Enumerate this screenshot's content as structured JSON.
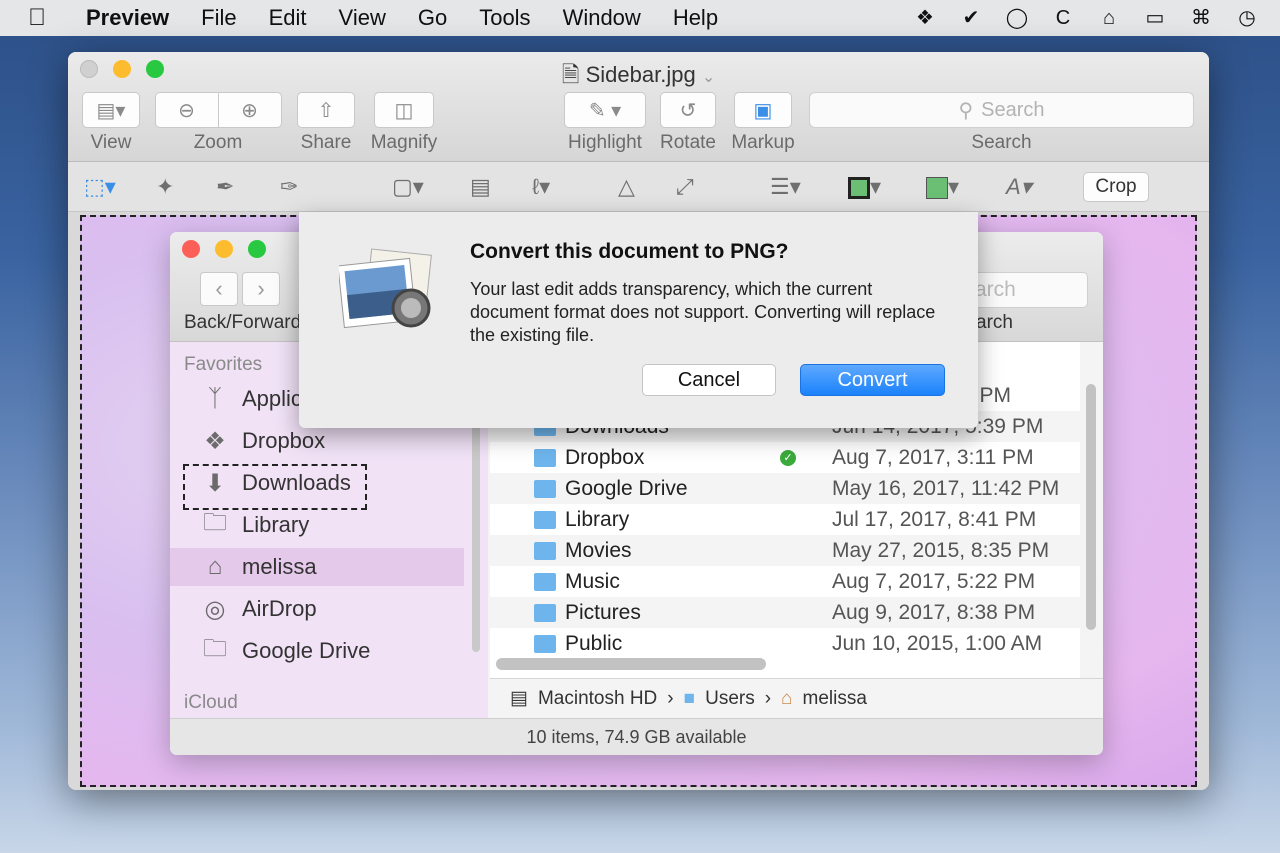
{
  "menubar": {
    "app": "Preview",
    "items": [
      "File",
      "Edit",
      "View",
      "Go",
      "Tools",
      "Window",
      "Help"
    ],
    "status_icons": [
      "dropbox-icon",
      "checkmark-icon",
      "1password-icon",
      "c-icon",
      "home-icon",
      "airplay-icon",
      "keyboard-icon",
      "time-machine-icon"
    ]
  },
  "preview": {
    "title": "Sidebar.jpg",
    "toolbar": {
      "view": "View",
      "zoom": "Zoom",
      "share": "Share",
      "magnify": "Magnify",
      "highlight": "Highlight",
      "rotate": "Rotate",
      "markup": "Markup",
      "search_placeholder": "Search",
      "search_label": "Search"
    },
    "markup": {
      "crop": "Crop"
    }
  },
  "finder": {
    "nav_label": "Back/Forward",
    "search_fragment": "arch",
    "search_label_fragment": "arch",
    "sidebar": {
      "favorites_heading": "Favorites",
      "icloud_heading": "iCloud",
      "items": [
        {
          "label": "Applic",
          "icon": "applications-icon"
        },
        {
          "label": "Dropbox",
          "icon": "dropbox-icon"
        },
        {
          "label": "Downloads",
          "icon": "downloads-icon"
        },
        {
          "label": "Library",
          "icon": "folder-icon"
        },
        {
          "label": "melissa",
          "icon": "home-icon"
        },
        {
          "label": "AirDrop",
          "icon": "airdrop-icon"
        },
        {
          "label": "Google Drive",
          "icon": "folder-icon"
        }
      ]
    },
    "rows": [
      {
        "name": "",
        "date": "2 PM"
      },
      {
        "name": "Downloads",
        "date": "Jun 14, 2017, 5:39 PM"
      },
      {
        "name": "Dropbox",
        "date": "Aug 7, 2017, 3:11 PM",
        "synced": true
      },
      {
        "name": "Google Drive",
        "date": "May 16, 2017, 11:42 PM"
      },
      {
        "name": "Library",
        "date": "Jul 17, 2017, 8:41 PM"
      },
      {
        "name": "Movies",
        "date": "May 27, 2015, 8:35 PM"
      },
      {
        "name": "Music",
        "date": "Aug 7, 2017, 5:22 PM"
      },
      {
        "name": "Pictures",
        "date": "Aug 9, 2017, 8:38 PM"
      },
      {
        "name": "Public",
        "date": "Jun 10, 2015, 1:00 AM"
      }
    ],
    "path": [
      "Macintosh HD",
      "Users",
      "melissa"
    ],
    "status": "10 items, 74.9 GB available"
  },
  "sheet": {
    "title": "Convert this document to PNG?",
    "message": "Your last edit adds transparency, which the current document format does not support. Converting will replace the existing file.",
    "cancel": "Cancel",
    "convert": "Convert"
  },
  "colors": {
    "accent": "#1a82fb",
    "close": "#fc5f57",
    "minimize": "#fdbc2e",
    "zoom": "#28c840",
    "sidebar_selected": "#e5c9ea"
  }
}
